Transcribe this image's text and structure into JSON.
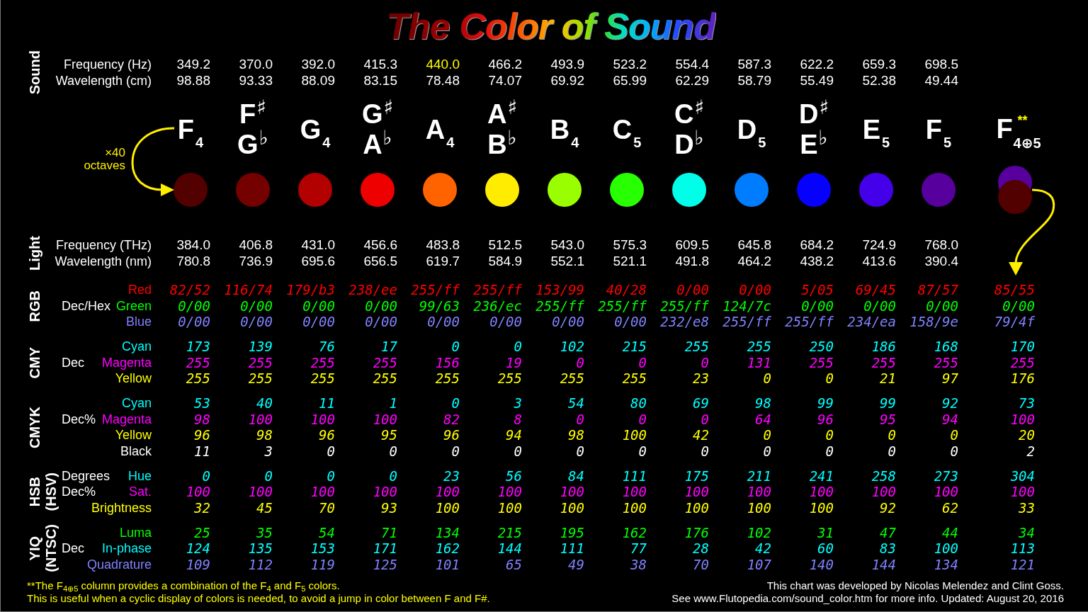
{
  "title": "The Color of Sound",
  "sound": {
    "label": "Sound",
    "rows": [
      {
        "label": "Frequency (Hz)",
        "values": [
          {
            "text": "349.2",
            "highlighted": false
          },
          {
            "text": "370.0",
            "highlighted": false
          },
          {
            "text": "392.0",
            "highlighted": false
          },
          {
            "text": "415.3",
            "highlighted": false
          },
          {
            "text": "440.0",
            "highlighted": true
          },
          {
            "text": "466.2",
            "highlighted": false
          },
          {
            "text": "493.9",
            "highlighted": false
          },
          {
            "text": "523.2",
            "highlighted": false
          },
          {
            "text": "554.4",
            "highlighted": false
          },
          {
            "text": "587.3",
            "highlighted": false
          },
          {
            "text": "622.2",
            "highlighted": false
          },
          {
            "text": "659.3",
            "highlighted": false
          },
          {
            "text": "698.5",
            "highlighted": false
          }
        ]
      },
      {
        "label": "Wavelength (cm)",
        "values": [
          {
            "text": "98.88",
            "highlighted": false
          },
          {
            "text": "93.33",
            "highlighted": false
          },
          {
            "text": "88.09",
            "highlighted": false
          },
          {
            "text": "83.15",
            "highlighted": false
          },
          {
            "text": "78.48",
            "highlighted": false
          },
          {
            "text": "74.07",
            "highlighted": false
          },
          {
            "text": "69.92",
            "highlighted": false
          },
          {
            "text": "65.99",
            "highlighted": false
          },
          {
            "text": "62.29",
            "highlighted": false
          },
          {
            "text": "58.79",
            "highlighted": false
          },
          {
            "text": "55.49",
            "highlighted": false
          },
          {
            "text": "52.38",
            "highlighted": false
          },
          {
            "text": "49.44",
            "highlighted": false
          }
        ]
      }
    ]
  },
  "annotation": "×40 octaves",
  "notes": [
    {
      "kind": "natural",
      "name": "F$_{4}$",
      "color": "#520000"
    },
    {
      "kind": "accidental",
      "sharp": "F$^{♯}$",
      "flat": "G$^{♭}$",
      "color": "#740000"
    },
    {
      "kind": "natural",
      "name": "G$_{4}$",
      "color": "#b30000"
    },
    {
      "kind": "accidental",
      "sharp": "G$^{♯}$",
      "flat": "A$^{♭}$",
      "color": "#ee0000"
    },
    {
      "kind": "natural",
      "name": "A$_{4}$",
      "color": "#ff6300"
    },
    {
      "kind": "accidental",
      "sharp": "A$^{♯}$",
      "flat": "B$^{♭}$",
      "color": "#ffec00"
    },
    {
      "kind": "natural",
      "name": "B$_{4}$",
      "color": "#99ff00"
    },
    {
      "kind": "natural",
      "name": "C$_{5}$",
      "color": "#28ff00"
    },
    {
      "kind": "accidental",
      "sharp": "C$^{♯}$",
      "flat": "D$^{♭}$",
      "color": "#00ffe8"
    },
    {
      "kind": "natural",
      "name": "D$_{5}$",
      "color": "#007cff"
    },
    {
      "kind": "accidental",
      "sharp": "D$^{♯}$",
      "flat": "E$^{♭}$",
      "color": "#0500ff"
    },
    {
      "kind": "natural",
      "name": "E$_{5}$",
      "color": "#4500ea"
    },
    {
      "kind": "natural",
      "name": "F$_{5}$",
      "color": "#57009e"
    },
    {
      "kind": "combined",
      "letter": "F",
      "subscript": "4⊕5",
      "mark": "**",
      "circles": [
        {
          "color": "#57009e"
        },
        {
          "color": "#520000"
        }
      ]
    }
  ],
  "light": {
    "label": "Light",
    "rows": [
      {
        "label": "Frequency (THz)",
        "values": [
          "384.0",
          "406.8",
          "431.0",
          "456.6",
          "483.8",
          "512.5",
          "543.0",
          "575.3",
          "609.5",
          "645.8",
          "684.2",
          "724.9",
          "768.0"
        ]
      },
      {
        "label": "Wavelength (nm)",
        "values": [
          "780.8",
          "736.9",
          "695.6",
          "656.5",
          "619.7",
          "584.9",
          "552.1",
          "521.1",
          "491.8",
          "464.2",
          "438.2",
          "413.6",
          "390.4"
        ]
      }
    ]
  },
  "color_spaces": [
    {
      "label": "RGB",
      "rows": [
        {
          "label": "Red",
          "color": "#ff0000",
          "values": [
            "82/52",
            "116/74",
            "179/b3",
            "238/ee",
            "255/ff",
            "255/ff",
            "153/99",
            "40/28",
            "0/00",
            "0/00",
            "5/05",
            "69/45",
            "87/57",
            "85/55"
          ]
        },
        {
          "unit": "Dec/Hex",
          "label": "Green",
          "color": "#00ff00",
          "values": [
            "0/00",
            "0/00",
            "0/00",
            "0/00",
            "99/63",
            "236/ec",
            "255/ff",
            "255/ff",
            "255/ff",
            "124/7c",
            "0/00",
            "0/00",
            "0/00",
            "0/00"
          ]
        },
        {
          "label": "Blue",
          "color": "#8080ff",
          "values": [
            "0/00",
            "0/00",
            "0/00",
            "0/00",
            "0/00",
            "0/00",
            "0/00",
            "0/00",
            "232/e8",
            "255/ff",
            "255/ff",
            "234/ea",
            "158/9e",
            "79/4f"
          ]
        }
      ]
    },
    {
      "label": "CMY",
      "rows": [
        {
          "label": "Cyan",
          "color": "#00ffff",
          "values": [
            "173",
            "139",
            "76",
            "17",
            "0",
            "0",
            "102",
            "215",
            "255",
            "255",
            "250",
            "186",
            "168",
            "170"
          ]
        },
        {
          "unit": "Dec",
          "label": "Magenta",
          "color": "#ff00ff",
          "values": [
            "255",
            "255",
            "255",
            "255",
            "156",
            "19",
            "0",
            "0",
            "0",
            "131",
            "255",
            "255",
            "255",
            "255"
          ]
        },
        {
          "label": "Yellow",
          "color": "#ffff00",
          "values": [
            "255",
            "255",
            "255",
            "255",
            "255",
            "255",
            "255",
            "255",
            "23",
            "0",
            "0",
            "21",
            "97",
            "176"
          ]
        }
      ]
    },
    {
      "label": "CMYK",
      "rows": [
        {
          "label": "Cyan",
          "color": "#00ffff",
          "values": [
            "53",
            "40",
            "11",
            "1",
            "0",
            "3",
            "54",
            "80",
            "69",
            "98",
            "99",
            "99",
            "92",
            "73"
          ]
        },
        {
          "unit": "Dec%",
          "label": "Magenta",
          "color": "#ff00ff",
          "values": [
            "98",
            "100",
            "100",
            "100",
            "82",
            "8",
            "0",
            "0",
            "0",
            "64",
            "96",
            "95",
            "94",
            "100"
          ]
        },
        {
          "label": "Yellow",
          "color": "#ffff00",
          "values": [
            "96",
            "98",
            "96",
            "95",
            "96",
            "94",
            "98",
            "100",
            "42",
            "0",
            "0",
            "0",
            "0",
            "20"
          ]
        },
        {
          "label": "Black",
          "color": "#ffffff",
          "values": [
            "11",
            "3",
            "0",
            "0",
            "0",
            "0",
            "0",
            "0",
            "0",
            "0",
            "0",
            "0",
            "0",
            "2"
          ]
        }
      ]
    },
    {
      "label": "HSB",
      "sublabel": "(HSV)",
      "rows": [
        {
          "unit": "Degrees",
          "label": "Hue",
          "color": "#00ffff",
          "values": [
            "0",
            "0",
            "0",
            "0",
            "23",
            "56",
            "84",
            "111",
            "175",
            "211",
            "241",
            "258",
            "273",
            "304"
          ]
        },
        {
          "unit": "Dec%",
          "label": "Sat.",
          "color": "#ff00ff",
          "values": [
            "100",
            "100",
            "100",
            "100",
            "100",
            "100",
            "100",
            "100",
            "100",
            "100",
            "100",
            "100",
            "100",
            "100"
          ]
        },
        {
          "label": "Brightness",
          "color": "#ffff00",
          "values": [
            "32",
            "45",
            "70",
            "93",
            "100",
            "100",
            "100",
            "100",
            "100",
            "100",
            "100",
            "92",
            "62",
            "33"
          ]
        }
      ]
    },
    {
      "label": "YIQ",
      "sublabel": "(NTSC)",
      "rows": [
        {
          "label": "Luma",
          "color": "#00ff00",
          "values": [
            "25",
            "35",
            "54",
            "71",
            "134",
            "215",
            "195",
            "162",
            "176",
            "102",
            "31",
            "47",
            "44",
            "34"
          ]
        },
        {
          "unit": "Dec",
          "label": "In-phase",
          "color": "#00ffff",
          "values": [
            "124",
            "135",
            "153",
            "171",
            "162",
            "144",
            "111",
            "77",
            "28",
            "42",
            "60",
            "83",
            "100",
            "113"
          ]
        },
        {
          "label": "Quadrature",
          "color": "#8080ff",
          "values": [
            "109",
            "112",
            "119",
            "125",
            "101",
            "65",
            "49",
            "38",
            "70",
            "107",
            "140",
            "144",
            "134",
            "121"
          ]
        }
      ]
    }
  ],
  "footnote": {
    "mark": "**",
    "text": "The F$_{4⊕5}$ column provides a combination of the F$_{4}$ and F$_{5}$ colors.",
    "continuation": "This is useful when a cyclic display of colors is needed, to avoid a jump in color between F and F#."
  },
  "credits": [
    "This chart was developed by Nicolas Melendez and Clint Goss.",
    "See www.Flutopedia.com/sound_color.htm for more info. Updated: August 20, 2016"
  ]
}
